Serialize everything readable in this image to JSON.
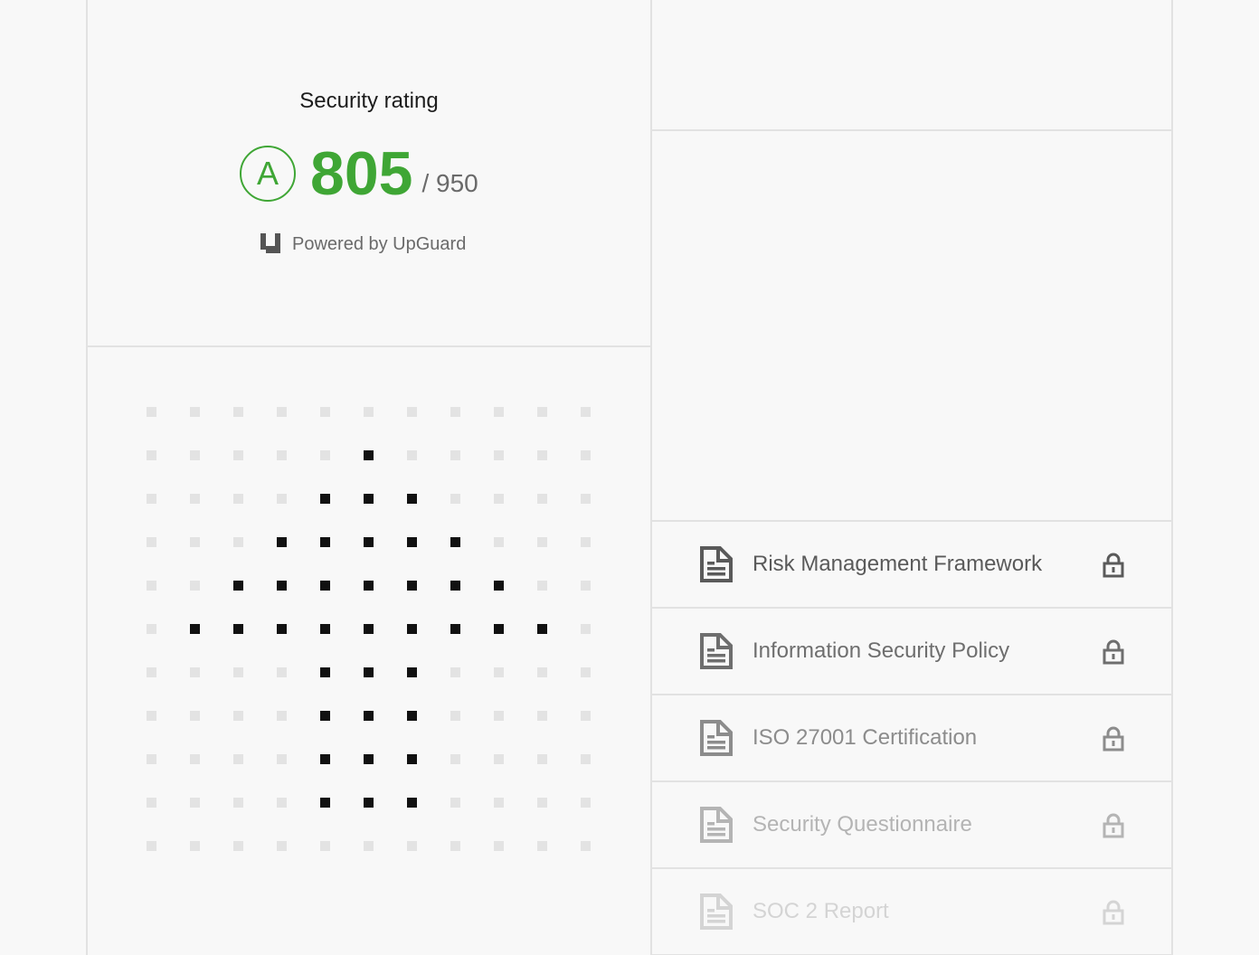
{
  "rating": {
    "title": "Security rating",
    "grade": "A",
    "score": "805",
    "max": "/ 950",
    "powered_by": "Powered by UpGuard",
    "accent": "#3fa635"
  },
  "documents": [
    {
      "label": "Risk Management Framework",
      "color": "#5a5a5a",
      "icon": "document-icon",
      "locked": true
    },
    {
      "label": "Information Security Policy",
      "color": "#6e6e6e",
      "icon": "document-icon",
      "locked": true
    },
    {
      "label": "ISO 27001 Certification",
      "color": "#8c8c8c",
      "icon": "document-icon",
      "locked": true
    },
    {
      "label": "Security Questionnaire",
      "color": "#b4b4b4",
      "icon": "document-icon",
      "locked": true
    },
    {
      "label": "SOC 2 Report",
      "color": "#d4d4d4",
      "icon": "document-icon",
      "locked": true
    }
  ],
  "dot_pattern": {
    "active_color": "#111111",
    "inactive_color": "#e3e3e3",
    "rows": [
      "00000000000",
      "00000100000",
      "00001110000",
      "00011111000",
      "00111111100",
      "01111111110",
      "00001110000",
      "00001110000",
      "00001110000",
      "00001110000",
      "00000000000"
    ]
  }
}
